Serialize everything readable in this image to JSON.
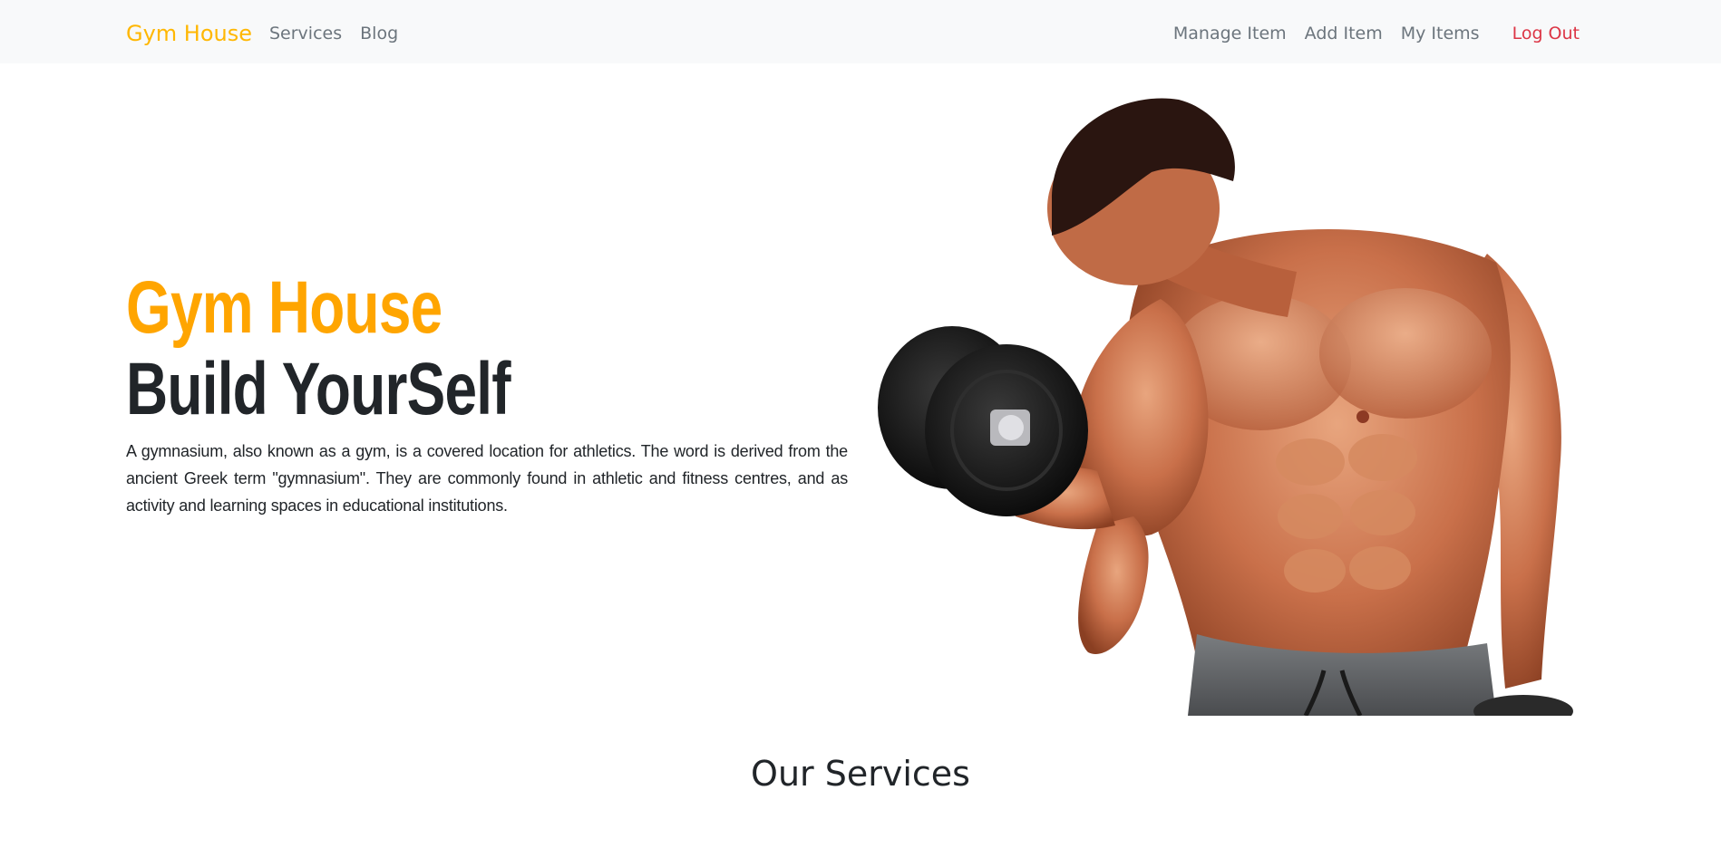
{
  "navbar": {
    "brand": "Gym House",
    "left_links": [
      "Services",
      "Blog"
    ],
    "right_links": [
      "Manage Item",
      "Add Item",
      "My Items"
    ],
    "logout": "Log Out"
  },
  "hero": {
    "title": "Gym House",
    "subtitle": "Build YourSelf",
    "description": "A gymnasium, also known as a gym, is a covered location for athletics. The word is derived from the ancient Greek term \"gymnasium\". They are commonly found in athletic and fitness centres, and as activity and learning spaces in educational institutions.",
    "image_label": "man-lifting-dumbbell"
  },
  "services": {
    "heading": "Our Services"
  },
  "colors": {
    "brand": "#ffb703",
    "hero_title": "#ffa500",
    "logout": "#dc3545",
    "nav_link": "#6c757d",
    "navbar_bg": "#f8f9fa",
    "text": "#212529"
  }
}
